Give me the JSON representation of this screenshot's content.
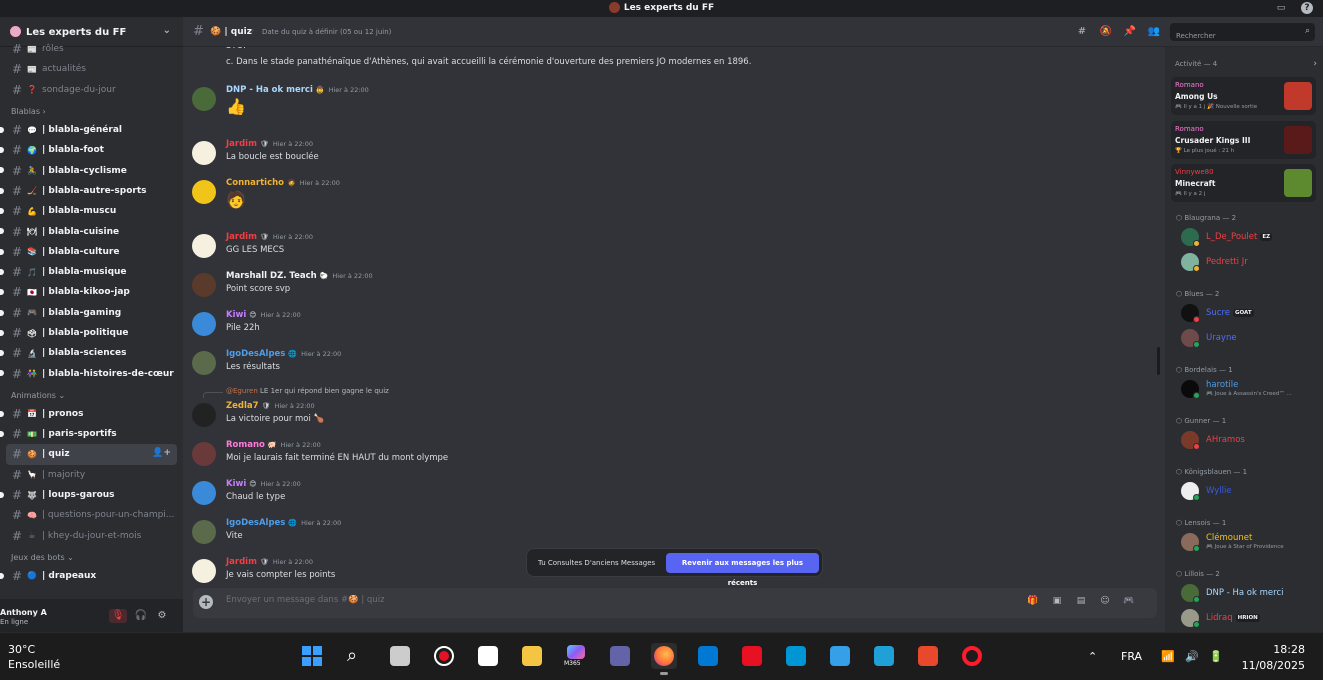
{
  "window": {
    "title": "Les experts du FF"
  },
  "server": {
    "name": "Les experts du FF"
  },
  "sidebar": {
    "top_channels": [
      {
        "emoji": "📰",
        "name": "rôles",
        "muted": true
      },
      {
        "emoji": "📰",
        "name": "actualités",
        "muted": true
      },
      {
        "emoji": "❓",
        "name": "sondage-du-jour",
        "muted": true
      }
    ],
    "cat_blablas": "Blablas",
    "blablas": [
      {
        "emoji": "💬",
        "name": "| blabla-général"
      },
      {
        "emoji": "🌍",
        "name": "| blabla-foot"
      },
      {
        "emoji": "🚴",
        "name": "| blabla-cyclisme"
      },
      {
        "emoji": "🏒",
        "name": "| blabla-autre-sports"
      },
      {
        "emoji": "💪",
        "name": "| blabla-muscu"
      },
      {
        "emoji": "🍽",
        "name": "| blabla-cuisine"
      },
      {
        "emoji": "📚",
        "name": "| blabla-culture"
      },
      {
        "emoji": "🎵",
        "name": "| blabla-musique"
      },
      {
        "emoji": "🇯🇵",
        "name": "| blabla-kikoo-jap"
      },
      {
        "emoji": "🎮",
        "name": "| blabla-gaming"
      },
      {
        "emoji": "🗳",
        "name": "| blabla-politique"
      },
      {
        "emoji": "🔬",
        "name": "| blabla-sciences"
      },
      {
        "emoji": "👫",
        "name": "| blabla-histoires-de-cœur"
      }
    ],
    "cat_animations": "Animations",
    "animations": [
      {
        "emoji": "📅",
        "name": "| pronos",
        "muted": false
      },
      {
        "emoji": "💵",
        "name": "| paris-sportifs",
        "muted": false
      },
      {
        "emoji": "🍪",
        "name": "| quiz",
        "muted": false,
        "active": true
      },
      {
        "emoji": "🦙",
        "name": "| majority",
        "muted": true
      },
      {
        "emoji": "🐺",
        "name": "| loups-garous",
        "muted": false
      },
      {
        "emoji": "🧠",
        "name": "| questions-pour-un-champi...",
        "muted": true
      },
      {
        "emoji": "☕",
        "name": "| khey-du-jour-et-mois",
        "muted": true
      }
    ],
    "cat_bots": "Jeux des bots",
    "bots": [
      {
        "emoji": "🔵",
        "name": "| drapeaux"
      }
    ]
  },
  "user": {
    "name": "Anthony A",
    "status": "En ligne"
  },
  "channel": {
    "emoji": "🍪",
    "name": "| quiz",
    "topic": "Date du quiz à définir (05 ou 12 juin)"
  },
  "search": {
    "placeholder": "Rechercher"
  },
  "messages": [
    {
      "type": "cont",
      "text": "STOP"
    },
    {
      "type": "cont",
      "text": "c. Dans le stade panathénaïque d'Athènes, qui avait accueilli la cérémonie d'ouverture des premiers JO modernes en 1896."
    },
    {
      "type": "msg",
      "author": "DNP - Ha ok merci",
      "color": "#a8d8ff",
      "badge": "🤠",
      "time": "Hier à 22:00",
      "text": "",
      "sticker": "👍"
    },
    {
      "type": "msg",
      "author": "Jardim",
      "color": "#f23f43",
      "badge": "🛡",
      "time": "Hier à 22:00",
      "text": "La boucle est bouclée"
    },
    {
      "type": "msg",
      "author": "Connarticho",
      "color": "#f0b232",
      "badge": "🧔",
      "time": "Hier à 22:00",
      "text": "",
      "sticker": "🧑"
    },
    {
      "type": "msg",
      "author": "Jardim",
      "color": "#f23f43",
      "badge": "🛡",
      "time": "Hier à 22:00",
      "text": "GG LES MECS"
    },
    {
      "type": "msg",
      "author": "Marshall DZ. Teach",
      "color": "#f2f3f5",
      "badge": "🐑",
      "time": "Hier à 22:00",
      "text": "Point score svp"
    },
    {
      "type": "msg",
      "author": "Kiwi",
      "color": "#c77dff",
      "badge": "😊",
      "time": "Hier à 22:00",
      "text": "Pile 22h"
    },
    {
      "type": "msg",
      "author": "IgoDesAlpes",
      "color": "#4f9de8",
      "badge": "🌐",
      "time": "Hier à 22:00",
      "text": "Les résultats"
    },
    {
      "type": "reply",
      "reply_name": "@Eguren",
      "reply_text": "LE 1er qui répond bien gagne le quiz",
      "author": "Zedla7",
      "color": "#f0b232",
      "badge": "🛡",
      "time": "Hier à 22:00",
      "text": "La victoire pour moi 🍗"
    },
    {
      "type": "msg",
      "author": "Romano",
      "color": "#ff7ad9",
      "badge": "🐖",
      "time": "Hier à 22:00",
      "text": "Moi je laurais fait terminé EN HAUT du mont olympe"
    },
    {
      "type": "msg",
      "author": "Kiwi",
      "color": "#c77dff",
      "badge": "😊",
      "time": "Hier à 22:00",
      "text": "Chaud le type"
    },
    {
      "type": "msg",
      "author": "IgoDesAlpes",
      "color": "#4f9de8",
      "badge": "🌐",
      "time": "Hier à 22:00",
      "text": "Vite"
    },
    {
      "type": "msg",
      "author": "Jardim",
      "color": "#f23f43",
      "badge": "🛡",
      "time": "Hier à 22:00",
      "text": "Je vais compter les points"
    }
  ],
  "old_messages": {
    "text": "Tu Consultes D'anciens Messages",
    "button": "Revenir aux messages les plus récents"
  },
  "composer": {
    "placeholder": "Envoyer un message dans #🍪 | quiz"
  },
  "activity": {
    "title": "Activité — 4",
    "cards": [
      {
        "user": "Romano",
        "user_color": "#ff7ad9",
        "game": "Among Us",
        "meta": "🎮 Il y a 1 j  🎉 Nouvelle sortie",
        "img": "#c0392b"
      },
      {
        "user": "Romano",
        "user_color": "#ff7ad9",
        "game": "Crusader Kings III",
        "meta": "🏆 Le plus joué : 21 h",
        "img": "#5a1a1a"
      },
      {
        "user": "Vinnywe80",
        "user_color": "#f23f43",
        "game": "Minecraft",
        "meta": "🎮 Il y a 2 j",
        "img": "#5d8a2e"
      }
    ]
  },
  "member_groups": [
    {
      "name": "Blaugrana — 2",
      "members": [
        {
          "name": "L_De_Poulet",
          "color": "#f23f43",
          "tag": "EZ",
          "sub": "",
          "status": "#f0b232",
          "av": "#2d6b4f"
        },
        {
          "name": "Pedretti Jr",
          "color": "#f23f43",
          "tag": "",
          "sub": "",
          "status": "#f0b232",
          "av": "#7fb3a0"
        }
      ]
    },
    {
      "name": "Blues — 2",
      "members": [
        {
          "name": "Sucre",
          "color": "#4f6ef7",
          "tag": "GOAT",
          "sub": "",
          "status": "#f23f43",
          "av": "#111111"
        },
        {
          "name": "Urayne",
          "color": "#4f6ef7",
          "tag": "",
          "sub": "",
          "status": "#23a55a",
          "av": "#6e4a4a"
        }
      ]
    },
    {
      "name": "Bordelais — 1",
      "members": [
        {
          "name": "harotile",
          "color": "#4f9de8",
          "tag": "",
          "sub": "🎮 Joue à Assassin's Creed™ ...",
          "status": "#23a55a",
          "av": "#0a0a0a"
        }
      ]
    },
    {
      "name": "Gunner — 1",
      "members": [
        {
          "name": "AHramos",
          "color": "#f23f43",
          "tag": "",
          "sub": "",
          "status": "#f23f43",
          "av": "#7a3a2a"
        }
      ]
    },
    {
      "name": "Königsblauen — 1",
      "members": [
        {
          "name": "Wyllie",
          "color": "#3b5bd9",
          "tag": "",
          "sub": "",
          "status": "#23a55a",
          "av": "#eeeeee"
        }
      ]
    },
    {
      "name": "Lensois — 1",
      "members": [
        {
          "name": "Clémounet",
          "color": "#f0c419",
          "tag": "",
          "sub": "🎮 Joue à Star of Providence",
          "status": "#23a55a",
          "av": "#8a6a5a"
        }
      ]
    },
    {
      "name": "Lillois — 2",
      "members": [
        {
          "name": "DNP - Ha ok merci",
          "color": "#a8d8ff",
          "tag": "",
          "sub": "",
          "status": "#23a55a",
          "av": "#4a6a3a"
        },
        {
          "name": "Lidraq",
          "color": "#f23f43",
          "tag": "HRION",
          "sub": "",
          "status": "#23a55a",
          "av": "#9a9a8a"
        }
      ]
    }
  ],
  "taskbar": {
    "temp": "30°C",
    "condition": "Ensoleillé",
    "lang": "FRA",
    "time": "18:28",
    "date": "11/08/2025",
    "apps": [
      {
        "name": "start",
        "color": "#3aa0ff"
      },
      {
        "name": "search",
        "color": "#ffffff"
      },
      {
        "name": "task-view",
        "color": "#cccccc"
      },
      {
        "name": "record",
        "color": "#e81123"
      },
      {
        "name": "notepad",
        "color": "#ffffff"
      },
      {
        "name": "file-explorer",
        "color": "#f4c542"
      },
      {
        "name": "m365",
        "color": "#8b5cf6"
      },
      {
        "name": "teams",
        "color": "#6264a7"
      },
      {
        "name": "firefox",
        "color": "#ff7139"
      },
      {
        "name": "outlook",
        "color": "#0078d4"
      },
      {
        "name": "tlc",
        "color": "#e81123"
      },
      {
        "name": "hp",
        "color": "#0096d6"
      },
      {
        "name": "store",
        "color": "#35a0e8"
      },
      {
        "name": "edge",
        "color": "#1fa0d6"
      },
      {
        "name": "ccleaner",
        "color": "#e8482c"
      },
      {
        "name": "opera",
        "color": "#ff1b2d"
      }
    ],
    "m365_label": "M365"
  }
}
